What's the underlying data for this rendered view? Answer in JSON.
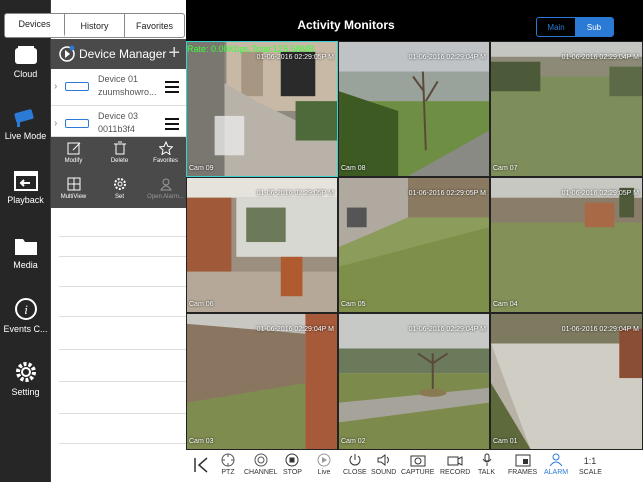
{
  "nav": [
    {
      "label": "Cloud",
      "icon": "cloud-icon"
    },
    {
      "label": "Live Mode",
      "icon": "camera-icon"
    },
    {
      "label": "Playback",
      "icon": "playback-icon"
    },
    {
      "label": "Media",
      "icon": "folder-icon"
    },
    {
      "label": "Events C...",
      "icon": "info-icon"
    },
    {
      "label": "Setting",
      "icon": "gear-icon"
    }
  ],
  "panel": {
    "tabs": [
      "Devices",
      "History",
      "Favorites"
    ],
    "active_tab": "Devices",
    "header": "Device Manager",
    "devices": [
      {
        "name": "Device 01",
        "sub": "zuumshowro..."
      },
      {
        "name": "Device 03",
        "sub": "0011b3f4"
      }
    ],
    "actions": [
      {
        "label": "Modify",
        "icon": "edit-icon"
      },
      {
        "label": "Delete",
        "icon": "trash-icon"
      },
      {
        "label": "Favorites",
        "icon": "star-icon"
      },
      {
        "label": "MultiView",
        "icon": "multiview-icon"
      },
      {
        "label": "Set",
        "icon": "settings-icon"
      },
      {
        "label": "Open Alarm...",
        "icon": "alarm-icon"
      }
    ]
  },
  "header": {
    "title": "Activity Monitors",
    "stream": [
      "Main",
      "Sub"
    ],
    "active_stream": "Sub"
  },
  "rate": "Rate: 0.00Kbps,Total:125.58MB",
  "cameras": [
    {
      "name": "Cam 09",
      "time": "01-06-2016 02:29:05P M"
    },
    {
      "name": "Cam 08",
      "time": "01-06-2016 02:29:04P M"
    },
    {
      "name": "Cam 07",
      "time": "01-06-2016 02:29:04P M"
    },
    {
      "name": "Cam 06",
      "time": "01-06-2016 02:29:05P M"
    },
    {
      "name": "Cam 05",
      "time": "01-06-2016 02:29:05P M"
    },
    {
      "name": "Cam 04",
      "time": "01-06-2016 02:29:05P M"
    },
    {
      "name": "Cam 03",
      "time": "01-06-2016 02:29:04P M"
    },
    {
      "name": "Cam 02",
      "time": "01-06-2016 02:29:04P M"
    },
    {
      "name": "Cam 01",
      "time": "01-06-2016 02:29:04P M"
    }
  ],
  "toolbar": [
    "PTZ",
    "CHANNEL",
    "STOP",
    "Live",
    "CLOSE",
    "SOUND",
    "CAPTURE",
    "RECORD",
    "TALK",
    "FRAMES",
    "ALARM",
    "SCALE"
  ],
  "colors": {
    "accent": "#2a7ad6",
    "rate": "#3bff3b",
    "selected": "#3bd0d0",
    "alarm": "#2a7ad6"
  }
}
